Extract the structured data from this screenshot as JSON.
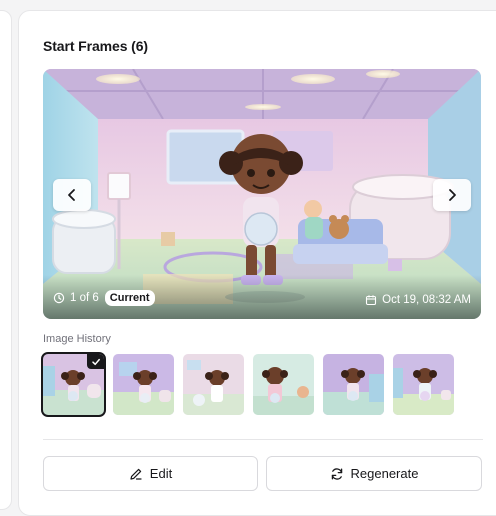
{
  "section": {
    "title": "Start Frames (6)"
  },
  "viewer": {
    "counter_text": "1 of 6",
    "current_badge": "Current",
    "timestamp": "Oct 19, 08:32 AM",
    "prev_icon": "chevron-left-icon",
    "next_icon": "chevron-right-icon"
  },
  "history": {
    "label": "Image History",
    "selected_index": 0,
    "thumbnails": [
      {
        "icon": "thumbnail-image",
        "selected": true
      },
      {
        "icon": "thumbnail-image",
        "selected": false
      },
      {
        "icon": "thumbnail-image",
        "selected": false
      },
      {
        "icon": "thumbnail-image",
        "selected": false
      },
      {
        "icon": "thumbnail-image",
        "selected": false
      },
      {
        "icon": "thumbnail-image",
        "selected": false
      }
    ]
  },
  "actions": {
    "edit_label": "Edit",
    "regenerate_label": "Regenerate"
  },
  "colors": {
    "accent": "#18181b",
    "border": "#e6e6e8",
    "muted_text": "#71717a"
  }
}
